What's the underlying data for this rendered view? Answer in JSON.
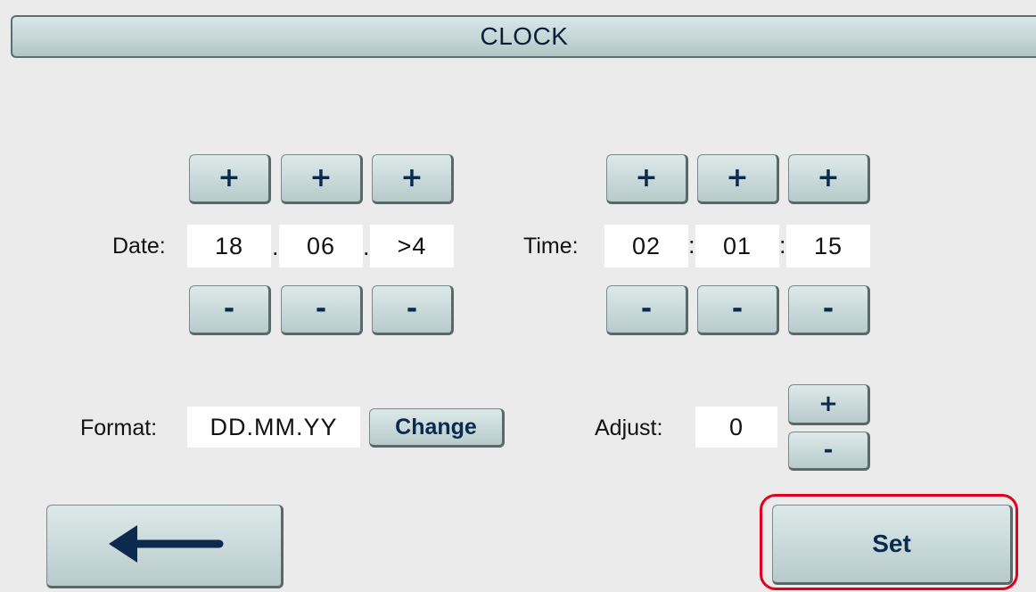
{
  "title": "CLOCK",
  "date": {
    "label": "Date:",
    "fields": [
      "18",
      "06",
      ">4"
    ],
    "separators": [
      ".",
      "."
    ],
    "plus_label": "+",
    "minus_label": "-"
  },
  "time": {
    "label": "Time:",
    "fields": [
      "02",
      "01",
      "15"
    ],
    "separators": [
      ":",
      ":"
    ],
    "plus_label": "+",
    "minus_label": "-"
  },
  "format": {
    "label": "Format:",
    "value": "DD.MM.YY",
    "change_label": "Change"
  },
  "adjust": {
    "label": "Adjust:",
    "value": "0",
    "plus_label": "+",
    "minus_label": "-"
  },
  "back_button": {
    "icon": "arrow-left-icon"
  },
  "set_button": {
    "label": "Set"
  },
  "colors": {
    "background": "#ebebeb",
    "button_top": "#dde9e9",
    "button_bottom": "#b8caca",
    "button_text": "#0b2a4d",
    "highlight": "#e4001b"
  }
}
